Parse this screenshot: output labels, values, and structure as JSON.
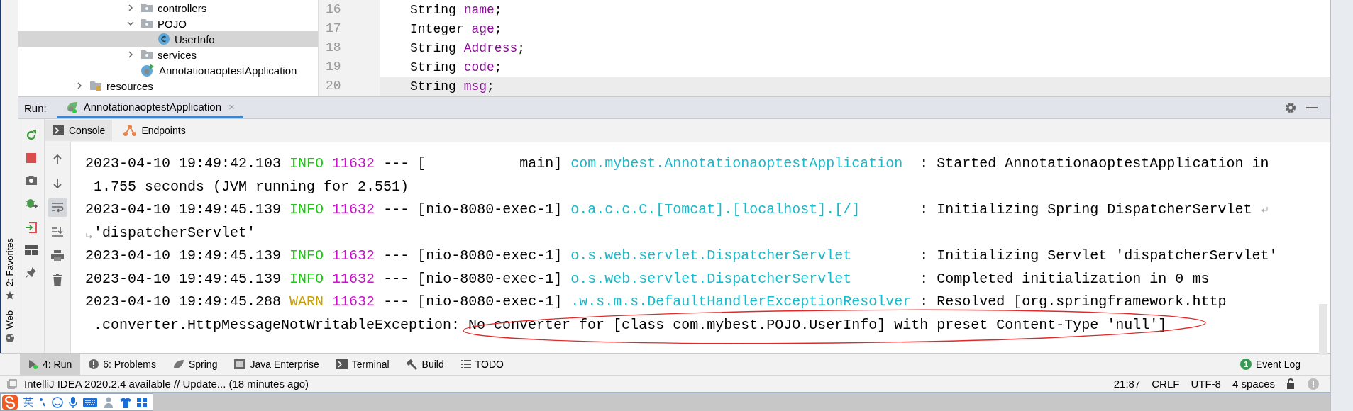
{
  "project_tree": {
    "items": [
      {
        "kind": "group",
        "children": [
          {
            "label": "controllers",
            "kind": "folder",
            "expanded": false,
            "selected": false
          },
          {
            "label": "POJO",
            "kind": "folder",
            "expanded": true,
            "selected": false,
            "children": [
              {
                "label": "UserInfo",
                "kind": "class",
                "selected": true
              }
            ]
          },
          {
            "label": "services",
            "kind": "folder",
            "expanded": false,
            "selected": false
          },
          {
            "label": "AnnotationaoptestApplication",
            "kind": "boot_class",
            "selected": false
          }
        ]
      },
      {
        "label": "resources",
        "kind": "resources_folder",
        "expanded": false,
        "selected": false
      }
    ]
  },
  "editor": {
    "lines": [
      {
        "number": "16",
        "type": "String",
        "name": "name",
        "punct": ";",
        "current": false
      },
      {
        "number": "17",
        "type": "Integer",
        "name": "age",
        "punct": ";",
        "current": false
      },
      {
        "number": "18",
        "type": "String",
        "name": "Address",
        "punct": ";",
        "current": false
      },
      {
        "number": "19",
        "type": "String",
        "name": "code",
        "punct": ";",
        "current": false
      },
      {
        "number": "20",
        "type": "String",
        "name": "msg",
        "punct": ";",
        "current": true
      }
    ]
  },
  "run": {
    "label": "Run:",
    "tabs": [
      {
        "label": "AnnotationaoptestApplication",
        "close": "×",
        "selected": true
      }
    ],
    "subtabs": [
      {
        "label": "Console",
        "kind": "console",
        "selected": true
      },
      {
        "label": "Endpoints",
        "kind": "endpoints",
        "selected": false
      }
    ],
    "side_tools": [
      {
        "kind": "rerun"
      },
      {
        "kind": "stop"
      },
      {
        "kind": "camera"
      },
      {
        "kind": "bug"
      },
      {
        "kind": "exit"
      },
      {
        "kind": "layout"
      },
      {
        "kind": "pin"
      }
    ],
    "console_tools": [
      {
        "kind": "up",
        "selected": false
      },
      {
        "kind": "down",
        "selected": false
      },
      {
        "kind": "soft_wrap",
        "selected": true
      },
      {
        "kind": "scroll_end",
        "selected": false
      },
      {
        "kind": "print",
        "selected": false
      },
      {
        "kind": "trash",
        "selected": false
      }
    ],
    "log": [
      {
        "timestamp": "2023-04-10 19:49:42.103",
        "kind": "info",
        "level": "INFO",
        "pid": "11632",
        "dashes": "---",
        "thread": "[           main]",
        "logger": "com.mybest.AnnotationaoptestApplication",
        "message": ": Started AnnotationaoptestApplication in",
        "continuation": "1.755 seconds (JVM running for 2.551)",
        "wrap_mark": false,
        "circled": false
      },
      {
        "timestamp": "2023-04-10 19:49:45.139",
        "kind": "info",
        "level": "INFO",
        "pid": "11632",
        "dashes": "---",
        "thread": "[nio-8080-exec-1]",
        "logger": "o.a.c.c.C.[Tomcat].[localhost].[/]",
        "message": ": Initializing Spring DispatcherServlet",
        "continuation": "'dispatcherServlet'",
        "wrap_mark": true,
        "circled": false
      },
      {
        "timestamp": "2023-04-10 19:49:45.139",
        "kind": "info",
        "level": "INFO",
        "pid": "11632",
        "dashes": "---",
        "thread": "[nio-8080-exec-1]",
        "logger": "o.s.web.servlet.DispatcherServlet",
        "message": ": Initializing Servlet 'dispatcherServlet'",
        "wrap_mark": false,
        "circled": false
      },
      {
        "timestamp": "2023-04-10 19:49:45.139",
        "kind": "info",
        "level": "INFO",
        "pid": "11632",
        "dashes": "---",
        "thread": "[nio-8080-exec-1]",
        "logger": "o.s.web.servlet.DispatcherServlet",
        "message": ": Completed initialization in 0 ms",
        "wrap_mark": false,
        "circled": false
      },
      {
        "timestamp": "2023-04-10 19:49:45.288",
        "kind": "warn",
        "level": "WARN",
        "pid": "11632",
        "dashes": "---",
        "thread": "[nio-8080-exec-1]",
        "logger": ".w.s.m.s.DefaultHandlerExceptionResolver",
        "message": ": Resolved [org.springframework.http",
        "continuation": ".converter.HttpMessageNotWritableException: No converter for [class com.mybest.POJO.UserInfo] with preset Content-Type 'null']",
        "wrap_mark": false,
        "circled": true
      }
    ]
  },
  "left_strip": [
    {
      "label": "2: Favorites",
      "kind": "star"
    },
    {
      "label": "Web",
      "kind": "globe"
    }
  ],
  "tool_tabs": [
    {
      "label": "4: Run",
      "kind": "run",
      "selected": true
    },
    {
      "label": "6: Problems",
      "kind": "problems",
      "selected": false
    },
    {
      "label": "Spring",
      "kind": "spring",
      "selected": false
    },
    {
      "label": "Java Enterprise",
      "kind": "enterprise",
      "selected": false
    },
    {
      "label": "Terminal",
      "kind": "terminal",
      "selected": false
    },
    {
      "label": "Build",
      "kind": "build",
      "selected": false
    },
    {
      "label": "TODO",
      "kind": "todo",
      "selected": false
    }
  ],
  "event_log": {
    "label": "Event Log",
    "badge": "1"
  },
  "status_bar": {
    "message": "IntelliJ IDEA 2020.2.4 available // Update... (18 minutes ago)",
    "items": [
      "21:87",
      "CRLF",
      "UTF-8",
      "4 spaces"
    ]
  },
  "ime_bar": {
    "label": "英"
  }
}
